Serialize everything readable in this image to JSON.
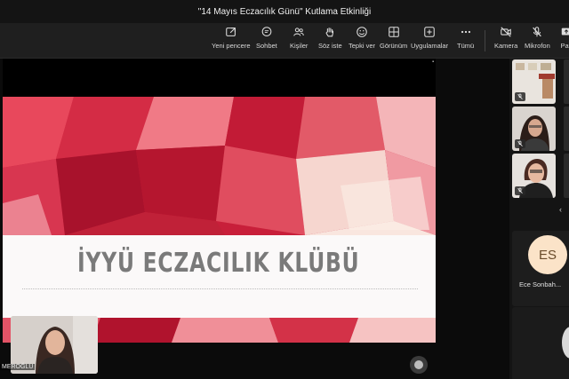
{
  "window": {
    "title": "\"14 Mayıs Eczacılık Günü\" Kutlama Etkinliği"
  },
  "toolbar": {
    "items": [
      {
        "label": "Yeni pencere",
        "icon": "new-window-icon"
      },
      {
        "label": "Sohbet",
        "icon": "chat-icon"
      },
      {
        "label": "Kişiler",
        "icon": "people-icon"
      },
      {
        "label": "Söz iste",
        "icon": "raise-hand-icon"
      },
      {
        "label": "Tepki ver",
        "icon": "react-icon"
      },
      {
        "label": "Görünüm",
        "icon": "layout-icon"
      },
      {
        "label": "Uygulamalar",
        "icon": "apps-icon"
      },
      {
        "label": "Tümü",
        "icon": "more-icon"
      },
      {
        "label": "Kamera",
        "icon": "camera-off-icon"
      },
      {
        "label": "Mikrofon",
        "icon": "mic-off-icon"
      },
      {
        "label": "Pay",
        "icon": "share-icon"
      }
    ]
  },
  "slide": {
    "title": "İYYÜ ECZACILIK KLÜBÜ"
  },
  "self_view": {
    "name": "MEROĞLU"
  },
  "participants": {
    "featured": {
      "initials": "ES",
      "name": "Ece Sonbah..."
    }
  },
  "colors": {
    "background": "#0b0b0b",
    "toolbar": "#1f1f1f",
    "slide_red": "#c4243b",
    "avatar_bg": "#fbe3c8"
  }
}
